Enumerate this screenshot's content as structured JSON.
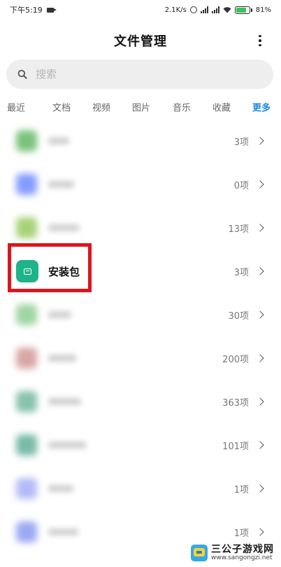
{
  "status_bar": {
    "time": "下午5:19",
    "net_speed": "2.1K/s",
    "battery_level": "81%",
    "battery_fraction": 0.81,
    "battery_color": "#39c35b"
  },
  "header": {
    "title": "文件管理"
  },
  "search": {
    "placeholder": "搜索"
  },
  "tabs": [
    {
      "label": "最近"
    },
    {
      "label": "文档"
    },
    {
      "label": "视频"
    },
    {
      "label": "图片"
    },
    {
      "label": "音乐"
    },
    {
      "label": "收藏"
    },
    {
      "label": "更多"
    }
  ],
  "accent_color": "#1b88e8",
  "list": [
    {
      "name": "",
      "count": "3项",
      "icon_color": "#4caf50",
      "blurred": true
    },
    {
      "name": "",
      "count": "0项",
      "icon_color": "#5b7cff",
      "blurred": true
    },
    {
      "name": "",
      "count": "13项",
      "icon_color": "#8bc34a",
      "blurred": true
    },
    {
      "name": "安装包",
      "count": "3项",
      "icon_color": "#1fb38a",
      "blurred": false
    },
    {
      "name": "",
      "count": "30项",
      "icon_color": "#81c784",
      "blurred": true
    },
    {
      "name": "",
      "count": "200项",
      "icon_color": "#c98a86",
      "blurred": true
    },
    {
      "name": "",
      "count": "363项",
      "icon_color": "#5fae8f",
      "blurred": true
    },
    {
      "name": "",
      "count": "101项",
      "icon_color": "#4aa58a",
      "blurred": true
    },
    {
      "name": "",
      "count": "1项",
      "icon_color": "#9aa5f5",
      "blurred": true
    },
    {
      "name": "",
      "count": "1项",
      "icon_color": "#7c8df0",
      "blurred": true
    }
  ],
  "highlight_color": "#e0141b",
  "watermark": {
    "title": "三公子游戏网",
    "url": "www.sangongzi.net"
  }
}
